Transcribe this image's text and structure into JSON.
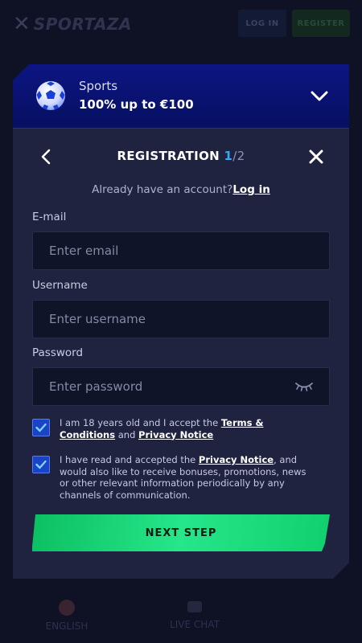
{
  "background": {
    "logo_text": "SPORTAZA",
    "login_label": "LOG IN",
    "register_label": "REGISTER",
    "language_label": "ENGLISH",
    "live_chat_label": "LIVE CHAT"
  },
  "promo": {
    "title": "Sports",
    "subtitle": "100% up to €100"
  },
  "form": {
    "title": "REGISTRATION",
    "step_current": "1",
    "step_total": "/2",
    "have_account_text": "Already have an account?",
    "login_link": "Log in",
    "email": {
      "label": "E-mail",
      "placeholder": "Enter email",
      "value": ""
    },
    "username": {
      "label": "Username",
      "placeholder": "Enter username",
      "value": ""
    },
    "password": {
      "label": "Password",
      "placeholder": "Enter password",
      "value": ""
    },
    "terms_checkbox": {
      "checked": true,
      "text_before": "I am 18 years old and I accept the ",
      "terms_link": "Terms & Conditions",
      "text_and": " and ",
      "privacy_link": "Privacy Notice"
    },
    "marketing_checkbox": {
      "checked": true,
      "text_before": "I have read and accepted the ",
      "privacy_link": "Privacy Notice",
      "text_after": ", and would also like to receive bonuses, promotions, news or other relevant information periodically by any channels of communication."
    },
    "next_button": "NEXT STEP"
  },
  "colors": {
    "accent_blue": "#38a8f0",
    "promo_bg": "#0c1582",
    "checkbox_blue": "#1a44c8",
    "cta_green": "#1fd97c"
  }
}
